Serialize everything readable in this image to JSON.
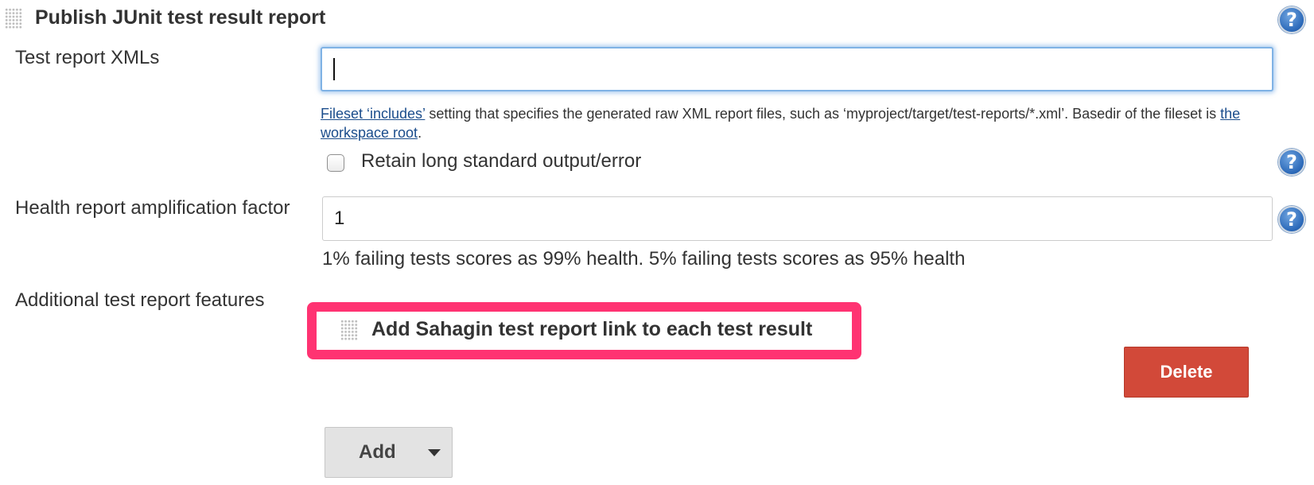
{
  "section": {
    "title": "Publish JUnit test result report"
  },
  "fields": {
    "test_report_xmls": {
      "label": "Test report XMLs",
      "value": ""
    },
    "description": {
      "link1": "Fileset ‘includes’",
      "text1": " setting that specifies the generated raw XML report files, such as ‘myproject/target/test-reports/*.xml’. Basedir of the fileset is ",
      "link2": "the workspace root",
      "text2": "."
    },
    "retain_output": {
      "label": "Retain long standard output/error",
      "checked": false
    },
    "health_factor": {
      "label": "Health report amplification factor",
      "value": "1",
      "hint": "1% failing tests scores as 99% health. 5% failing tests scores as 95% health"
    },
    "additional_features": {
      "label": "Additional test report features",
      "item_title": "Add Sahagin test report link to each test result"
    }
  },
  "buttons": {
    "delete_label": "Delete",
    "add_label": "Add"
  },
  "icons": {
    "help": "help-icon",
    "help_glyph": "?",
    "grip": "drag-handle-icon",
    "dropdown": "chevron-down-icon"
  },
  "colors": {
    "accent_link": "#1b4d8c",
    "delete": "#d24939",
    "highlight": "#ff3372",
    "help_blue": "#2a68b8"
  }
}
